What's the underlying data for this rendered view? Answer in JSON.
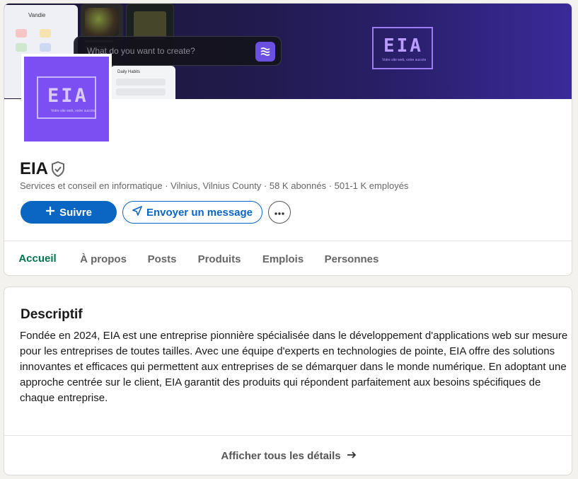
{
  "banner": {
    "search_placeholder": "What do you want to create?",
    "logo_word": "EIA",
    "logo_tagline": "Votre site web, votre succès",
    "mock_app_title": "Vandie",
    "mock_card_title": "Daily Habits"
  },
  "company": {
    "logo_word": "EIA",
    "logo_tagline": "Votre site web, votre succès",
    "name": "EIA",
    "meta": "Services et conseil en informatique · Vilnius, Vilnius County · 58 K abonnés · 501-1 K employés"
  },
  "actions": {
    "follow_label": "Suivre",
    "message_label": "Envoyer un message"
  },
  "tabs": [
    {
      "label": "Accueil",
      "active": true
    },
    {
      "label": "À propos",
      "active": false
    },
    {
      "label": "Posts",
      "active": false
    },
    {
      "label": "Produits",
      "active": false
    },
    {
      "label": "Emplois",
      "active": false
    },
    {
      "label": "Personnes",
      "active": false
    }
  ],
  "about": {
    "title": "Descriptif",
    "text": "Fondée en 2024, EIA est une entreprise pionnière spécialisée dans le développement d'applications web sur mesure pour les entreprises de toutes tailles. Avec une équipe d'experts en technologies de pointe, EIA offre des solutions innovantes et efficaces qui permettent aux entreprises de se démarquer dans le monde numérique. En adoptant une approche centrée sur le client, EIA garantit des produits qui répondent parfaitement aux besoins spécifiques de chaque entreprise.",
    "show_all_label": "Afficher tous les détails"
  },
  "colors": {
    "primary": "#0a66c2",
    "active_tab": "#01754f",
    "brand_purple": "#7c4ff2",
    "page_bg": "#f4f2ee"
  },
  "icons": {
    "verified": "shield-check-icon",
    "plus": "plus-icon",
    "send": "paper-plane-icon",
    "more": "more-horizontal-icon",
    "arrow": "arrow-right-icon"
  }
}
